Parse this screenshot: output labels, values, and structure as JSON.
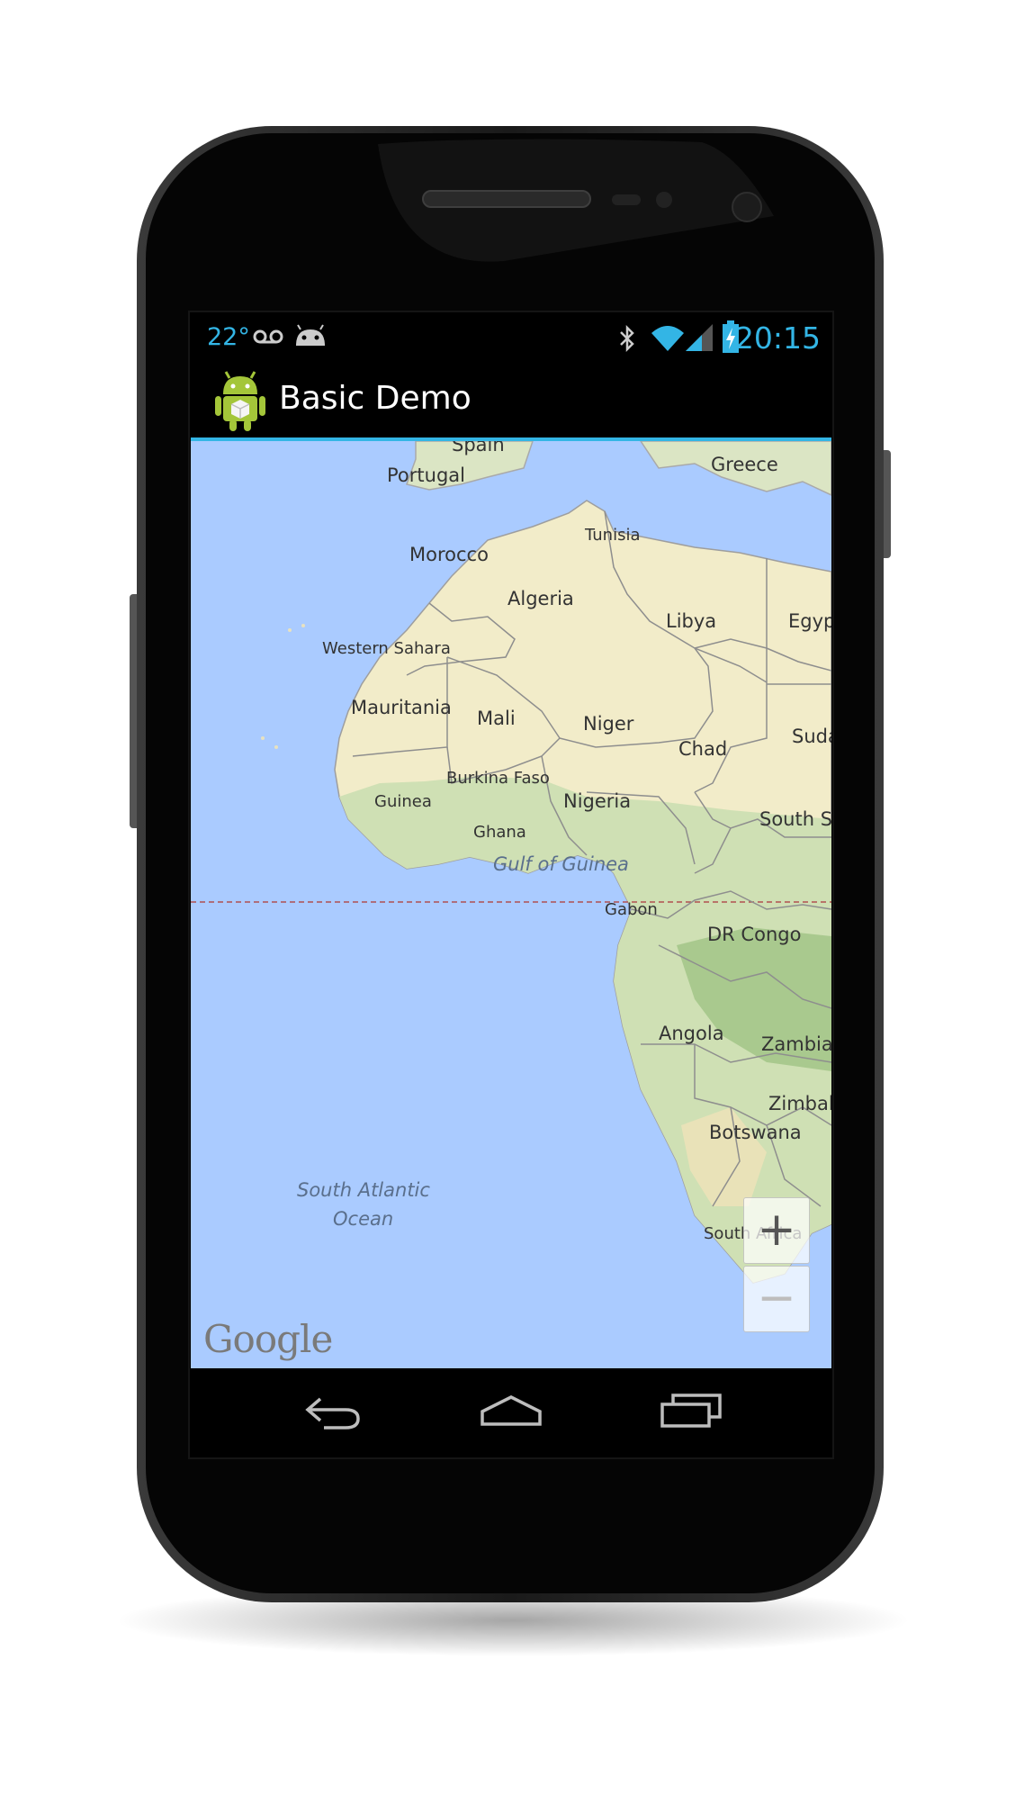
{
  "statusbar": {
    "temperature": "22°",
    "time": "20:15",
    "icons": [
      "voicemail-icon",
      "android-debug-icon",
      "bluetooth-icon",
      "wifi-icon",
      "signal-icon",
      "battery-charging-icon"
    ]
  },
  "actionbar": {
    "title": "Basic Demo",
    "icon": "android-app-icon"
  },
  "map": {
    "labels": {
      "spain": "Spain",
      "portugal": "Portugal",
      "greece": "Greece",
      "tunisia": "Tunisia",
      "morocco": "Morocco",
      "algeria": "Algeria",
      "libya": "Libya",
      "egypt": "Egypt",
      "western_sahara": "Western Sahara",
      "mauritania": "Mauritania",
      "mali": "Mali",
      "niger": "Niger",
      "chad": "Chad",
      "sudan": "Suda",
      "burkina_faso": "Burkina Faso",
      "guinea": "Guinea",
      "nigeria": "Nigeria",
      "ghana": "Ghana",
      "south_sudan": "South Su",
      "gulf_of_guinea": "Gulf of Guinea",
      "gabon": "Gabon",
      "dr_congo": "DR Congo",
      "angola": "Angola",
      "zambia": "Zambia",
      "zimbabwe": "Zimbab",
      "botswana": "Botswana",
      "south_atlantic_ocean_1": "South Atlantic",
      "south_atlantic_ocean_2": "Ocean",
      "south_africa": "South Africa"
    },
    "attribution": "Google",
    "zoom_in_label": "+",
    "zoom_out_label": "−"
  },
  "navbar": {
    "buttons": [
      "back-icon",
      "home-icon",
      "recent-apps-icon"
    ]
  },
  "colors": {
    "accent": "#33b5e5",
    "water": "#aacbff",
    "land_desert": "#f5f0d0",
    "land_green": "#cfe0b4"
  }
}
